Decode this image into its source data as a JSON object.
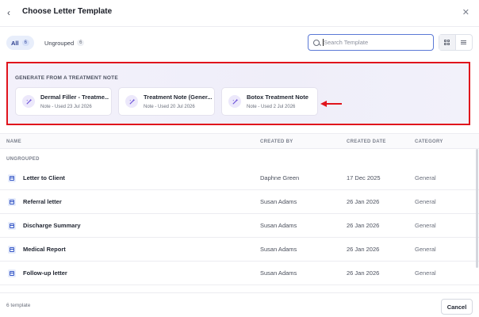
{
  "header": {
    "title": "Choose Letter Template"
  },
  "filters": {
    "all_label": "All",
    "all_count": "6",
    "ungrouped_label": "Ungrouped",
    "ungrouped_count": "6"
  },
  "search": {
    "placeholder": "Search Template",
    "value": ""
  },
  "treatment_notes": {
    "heading": "GENERATE FROM A TREATMENT NOTE",
    "cards": [
      {
        "name": "Dermal Filler - Treatme...",
        "sub": "Note - Used 23 Jul 2026"
      },
      {
        "name": "Treatment Note (Gener...",
        "sub": "Note - Used 20 Jul 2026"
      },
      {
        "name": "Botox Treatment Note",
        "sub": "Note - Used 2 Jul 2026"
      }
    ],
    "highlight_color": "#e0141c"
  },
  "table": {
    "columns": {
      "name": "NAME",
      "created_by": "CREATED BY",
      "created_date": "CREATED DATE",
      "category": "CATEGORY"
    },
    "group": "UNGROUPED",
    "rows": [
      {
        "name": "Letter to Client",
        "created_by": "Daphne Green",
        "date": "17 Dec 2025",
        "category": "General"
      },
      {
        "name": "Referral letter",
        "created_by": "Susan Adams",
        "date": "26 Jan 2026",
        "category": "General"
      },
      {
        "name": "Discharge Summary",
        "created_by": "Susan Adams",
        "date": "26 Jan 2026",
        "category": "General"
      },
      {
        "name": "Medical Report",
        "created_by": "Susan Adams",
        "date": "26 Jan 2026",
        "category": "General"
      },
      {
        "name": "Follow-up letter",
        "created_by": "Susan Adams",
        "date": "26 Jan 2026",
        "category": "General"
      }
    ]
  },
  "footer": {
    "count": "6 template",
    "cancel_label": "Cancel"
  }
}
